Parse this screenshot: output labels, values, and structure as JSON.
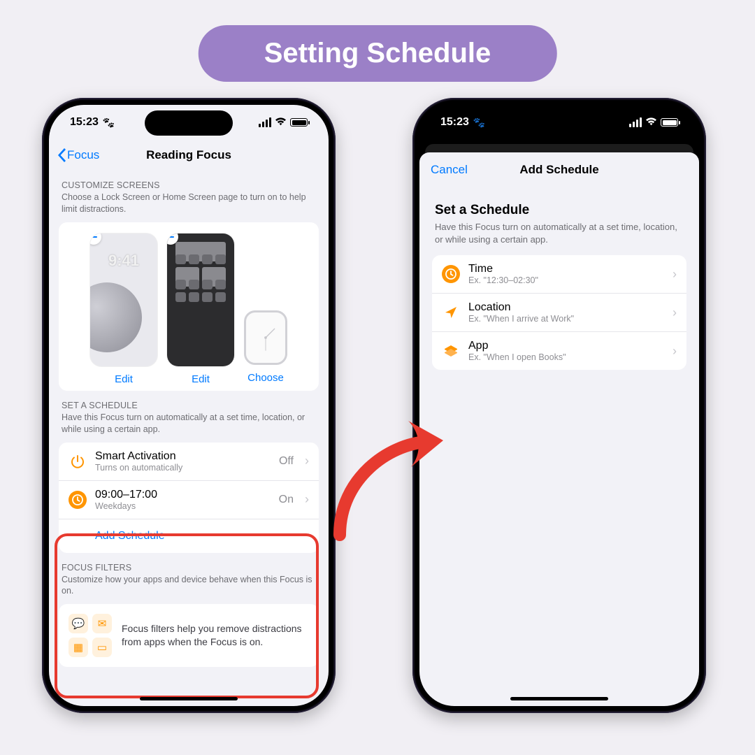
{
  "banner": "Setting Schedule",
  "status": {
    "time": "15:23"
  },
  "left": {
    "back": "Focus",
    "title": "Reading Focus",
    "customize": {
      "label": "CUSTOMIZE SCREENS",
      "desc": "Choose a Lock Screen or Home Screen page to turn on to help limit distractions.",
      "lock_time": "9:41",
      "edit": "Edit",
      "choose": "Choose"
    },
    "schedule": {
      "label": "SET A SCHEDULE",
      "desc": "Have this Focus turn on automatically at a set time, location, or while using a certain app.",
      "smart": {
        "title": "Smart Activation",
        "sub": "Turns on automatically",
        "value": "Off"
      },
      "time": {
        "title": "09:00–17:00",
        "sub": "Weekdays",
        "value": "On"
      },
      "add": "Add Schedule"
    },
    "filters": {
      "label": "FOCUS FILTERS",
      "desc": "Customize how your apps and device behave when this Focus is on.",
      "text": "Focus filters help you remove distractions from apps when the Focus is on."
    }
  },
  "right": {
    "cancel": "Cancel",
    "title": "Add Schedule",
    "h1": "Set a Schedule",
    "desc": "Have this Focus turn on automatically at a set time, location, or while using a certain app.",
    "rows": {
      "time": {
        "title": "Time",
        "sub": "Ex. \"12:30–02:30\""
      },
      "loc": {
        "title": "Location",
        "sub": "Ex. \"When I arrive at Work\""
      },
      "app": {
        "title": "App",
        "sub": "Ex. \"When I open Books\""
      }
    }
  }
}
